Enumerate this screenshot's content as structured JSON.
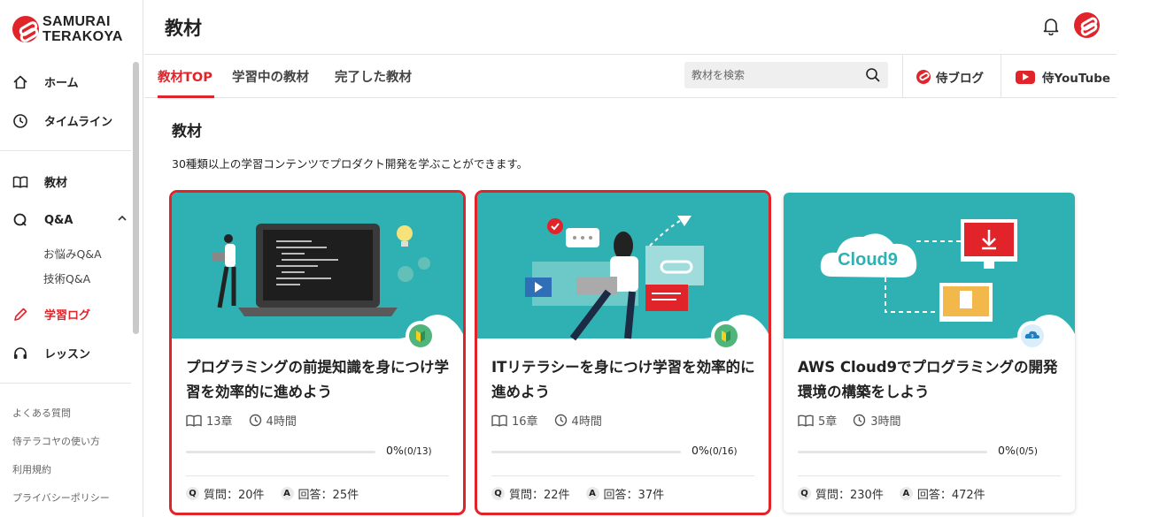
{
  "brand": {
    "line1": "SAMURAI",
    "line2": "TERAKOYA"
  },
  "sidebar": {
    "items": [
      {
        "label": "ホーム",
        "icon": "home-icon"
      },
      {
        "label": "タイムライン",
        "icon": "clock-icon"
      },
      {
        "label": "教材",
        "icon": "book-icon"
      },
      {
        "label": "Q&A",
        "icon": "qa-icon",
        "expanded": true
      },
      {
        "label": "学習ログ",
        "icon": "pencil-icon",
        "active": true
      },
      {
        "label": "レッスン",
        "icon": "headset-icon"
      }
    ],
    "qa_sub": [
      "お悩みQ&A",
      "技術Q&A"
    ],
    "footer_links": [
      "よくある質問",
      "侍テラコヤの使い方",
      "利用規約",
      "プライバシーポリシー"
    ]
  },
  "header": {
    "title": "教材"
  },
  "tabs": [
    {
      "label": "教材TOP",
      "active": true
    },
    {
      "label": "学習中の教材"
    },
    {
      "label": "完了した教材"
    }
  ],
  "search": {
    "placeholder": "教材を検索"
  },
  "external_links": {
    "blog": "侍ブログ",
    "youtube": "侍YouTube"
  },
  "main": {
    "title": "教材",
    "description": "30種類以上の学習コンテンツでプロダクト開発を学ぶことができます。"
  },
  "cards": [
    {
      "title": "プログラミングの前提知識を身につけ学習を効率的に進めよう",
      "chapters": "13章",
      "duration": "4時間",
      "progress_pct": "0%",
      "progress_count": "(0/13)",
      "progress": 0,
      "questions": "質問：20件",
      "answers": "回答：25件",
      "badge": "beginner-leaf-icon",
      "selected": true
    },
    {
      "title": "ITリテラシーを身につけ学習を効率的に進めよう",
      "chapters": "16章",
      "duration": "4時間",
      "progress_pct": "0%",
      "progress_count": "(0/16)",
      "progress": 0,
      "questions": "質問：22件",
      "answers": "回答：37件",
      "badge": "beginner-leaf-icon",
      "selected": true
    },
    {
      "title": "AWS Cloud9でプログラミングの開発環境の構築をしよう",
      "chapters": "5章",
      "duration": "3時間",
      "progress_pct": "0%",
      "progress_count": "(0/5)",
      "progress": 0,
      "questions": "質問：230件",
      "answers": "回答：472件",
      "badge": "cloud9-icon",
      "thumb_text": "Cloud9"
    }
  ],
  "qa_badges": {
    "q": "Q",
    "a": "A"
  },
  "colors": {
    "accent": "#e0242a",
    "thumb_bg": "#2fb1b3"
  }
}
